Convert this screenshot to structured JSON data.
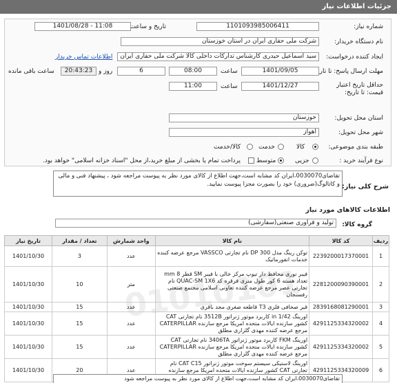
{
  "header": {
    "title": "جزئیات اطلاعات نیاز"
  },
  "form": {
    "need_number_label": "شماره نیاز:",
    "need_number_value": "1101093985006411",
    "announce_label": "تاریخ و ساعت اعلان عمومی:",
    "announce_value": "1401/08/28 - 11:08",
    "buyer_label": "نام دستگاه خریدار:",
    "buyer_value": "شرکت ملی حفاری ایران در استان خوزستان",
    "creator_label": "ایجاد کننده درخواست:",
    "creator_value": "سید اسماعیل حیدری کارشناس تدارکات داخلی کالا شرکت ملی حفاری ایران د",
    "contact_link": "اطلاعات تماس خریدار",
    "reply_deadline_label": "مهلت ارسال پاسخ: تا تاریخ:",
    "reply_date": "1401/09/05",
    "time_label": "ساعت",
    "reply_time": "08:00",
    "days_value": "6",
    "days_label": "روز و",
    "remaining_time": "20:43:23",
    "remaining_label": "ساعت باقی مانده",
    "price_validity_label": "حداقل تاریخ اعتبار قیمت: تا تاریخ:",
    "price_date": "1401/12/27",
    "price_time": "11:00",
    "province_label": "استان محل تحویل:",
    "province_value": "خوزستان",
    "city_label": "شهر محل تحویل:",
    "city_value": "اهواز",
    "category_label": "طبقه بندی موضوعی:",
    "category_options": [
      "کالا",
      "خدمت",
      "کالا/خدمت"
    ],
    "process_label": "نوع فرآیند خرید :",
    "process_options": [
      "جزیی",
      "متوسط"
    ],
    "payment_note": "پرداخت تمام یا بخشی از مبلغ خرید،از محل \"اسناد خزانه اسلامی\" خواهد بود."
  },
  "need": {
    "label": "شرح کلی نیاز:",
    "text": "تقاضای0030070،ایران کد مشابه است،جهت اطلاع از کالای مورد نظر به پیوست مراجعه شود ، پیشنهاد فنی و مالی و کاتالوگ(ضروری) خود را بصورت مجزا پیوست نمایید."
  },
  "goods": {
    "section_title": "اطلاعات کالاهای مورد نیاز",
    "group_label": "گروه کالا:",
    "group_value": "تولید و فرآوری صنعتی(سفارشی)",
    "columns": [
      "ردیف",
      "کد کالا",
      "نام کالا",
      "واحد شمارش",
      "تعداد / مقدار",
      "تاریخ نیاز"
    ],
    "rows": [
      {
        "row": "1",
        "code": "2239200017370001",
        "name": "توکن رینگ مدل 300 DP نام تجارتی VASSCO مرجع عرضه کننده خدمات انفورماتیک",
        "unit": "عدد",
        "qty": "3",
        "date": "1401/10/30"
      },
      {
        "row": "2",
        "code": "2281200090390001",
        "name": "فیبر نوری محافظ دار تیوپ مرکز خالی با فیبر SM قطر 8 mm تعداد هسته 6 کور طول متری فرقره کد QUAC-SM 1X6 نام تجارتی عصر مرجع عرضه کننده تعاونی اسلامی مجتمع صنعتی رفسنجان",
        "unit": "متر",
        "qty": "10",
        "date": "1401/10/30"
      },
      {
        "row": "3",
        "code": "2839168081290001",
        "name": "قیر صحافی فلزی T3 قاطعه صغری مجد باقری",
        "unit": "عدد",
        "qty": "15",
        "date": "1401/10/30"
      },
      {
        "row": "4",
        "code": "4291125334320002",
        "name": "اورینگ 1/42 in کاربرد موتور ژنراتور 3512B نام تجارتی CAT کشور سازنده ایالات متحده امریکا مرجع سازنده CATERPILLAR مرجع عرضه کننده مهدی گلزاری مطلق",
        "unit": "عدد",
        "qty": "15",
        "date": "1401/10/30"
      },
      {
        "row": "5",
        "code": "4291125334320002",
        "name": "اورینگ FKM کاربرد موتور ژنراتور 3406TA نام تجارتی CAT کشور سازنده ایالات متحده امریکا مرجع سازنده CATERPILLAR مرجع عرضه کننده مهدی گلزاری مطلق",
        "unit": "عدد",
        "qty": "15",
        "date": "1401/10/30"
      },
      {
        "row": "6",
        "code": "4291125334320009",
        "name": "اورینگ لاستیکی سیستم سوخت موتور ژنراتور CAT C15 نام تجارتی CAT کشور سازنده ایالات متحده امریکا مرجع سازنده CATERPILLAR مرجع عرضه کننده مهدی گلزاری مطلق",
        "unit": "عدد",
        "qty": "20",
        "date": "1401/10/30"
      }
    ]
  },
  "bottom_note": "تقاضای0030070،ایران کد مشابه است،جهت اطلاع از کالای مورد نظر به پیوست مراجعه شود"
}
